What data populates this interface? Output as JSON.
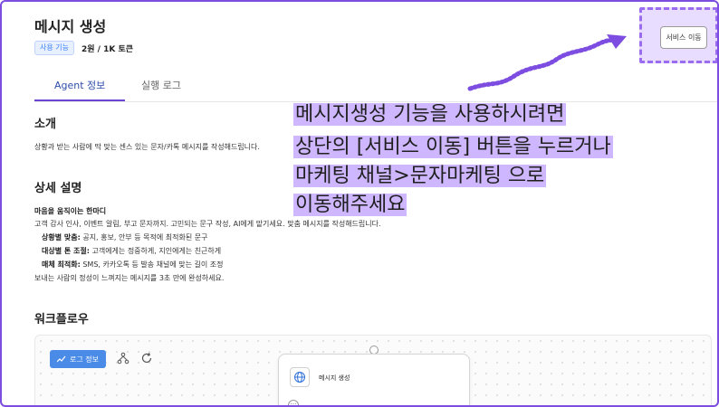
{
  "page": {
    "title": "메시지 생성"
  },
  "meta": {
    "badge": "사용 기능",
    "price": "2원 / 1K 토큰"
  },
  "header": {
    "service_button": "서비스 이동"
  },
  "tabs": [
    {
      "label": "Agent 정보"
    },
    {
      "label": "실행 로그"
    }
  ],
  "intro": {
    "heading": "소개",
    "text": "상황과 받는 사람에 딱 맞는 센스 있는 문자/카톡 메시지를 작성해드립니다."
  },
  "details": {
    "heading": "상세 설명",
    "subtitle": "마음을 움직이는 한마디",
    "line1": "고객 감사 인사, 이벤트 알림, 부고 문자까지. 고민되는 문구 작성, AI에게 맡기세요.",
    "line1_tail": "맞춤 메시지를 작성해드립니다.",
    "items": [
      {
        "label": "상황별 맞춤:",
        "text": " 공지, 홍보, 안부 등 목적에 최적화된 문구"
      },
      {
        "label": "대상별 톤 조절:",
        "text": " 고객에게는 정중하게, 지인에게는 친근하게"
      },
      {
        "label": "매체 최적화:",
        "text": " SMS, 카카오톡 등 발송 채널에 맞는 길이 조정"
      }
    ],
    "closing": "보내는 사람의 정성이 느껴지는 메시지를 3초 만에 완성하세요."
  },
  "workflow": {
    "heading": "워크플로우",
    "log_button": "로그 정보",
    "node_title": "메시지 생성",
    "more": "···"
  },
  "overlay": {
    "lines": [
      "메시지생성 기능을 사용하시려면",
      "상단의 [서비스 이동] 버튼을 누르거나",
      "마케팅 채널>문자마케팅 으로",
      "이동해주세요"
    ]
  },
  "colors": {
    "accent": "#6b46d6",
    "highlight": "#c6aaff",
    "primary_button": "#4a8be8",
    "badge_blue": "#3b82f6"
  }
}
